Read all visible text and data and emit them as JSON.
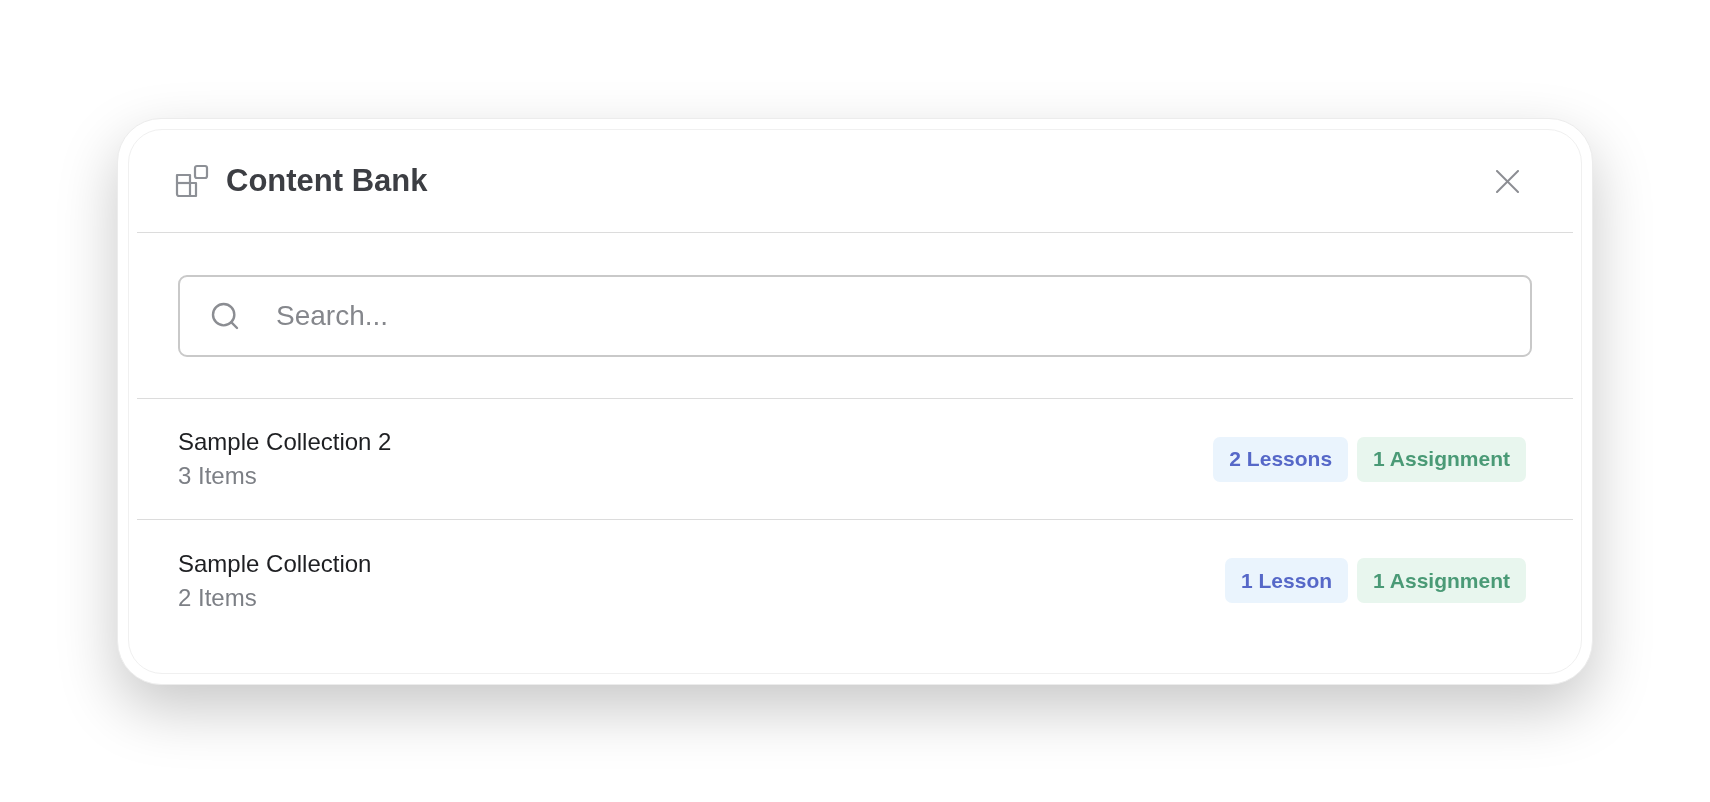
{
  "dialog": {
    "title": "Content Bank"
  },
  "search": {
    "placeholder": "Search..."
  },
  "collections": [
    {
      "name": "Sample Collection 2",
      "count": "3 Items",
      "tags": [
        {
          "kind": "lesson",
          "label": "2 Lessons"
        },
        {
          "kind": "assignment",
          "label": "1 Assignment"
        }
      ]
    },
    {
      "name": "Sample Collection",
      "count": "2 Items",
      "tags": [
        {
          "kind": "lesson",
          "label": "1 Lesson"
        },
        {
          "kind": "assignment",
          "label": "1 Assignment"
        }
      ]
    }
  ]
}
